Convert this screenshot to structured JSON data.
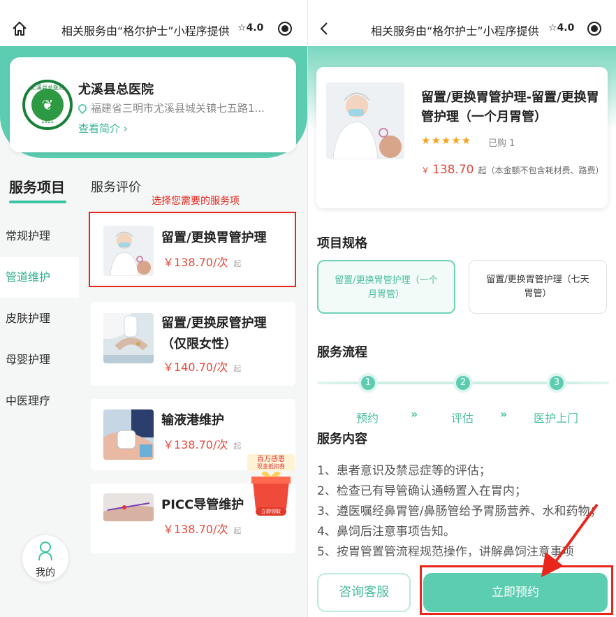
{
  "left": {
    "topbar": {
      "title": "相关服务由“格尔护士”小程序提供",
      "rating": "4.0"
    },
    "hospital": {
      "name": "尤溪县总医院",
      "address": "福建省三明市尤溪县城关镇七五路1...",
      "intro_link": "查看简介",
      "logo_text": "尤溪县总医院",
      "logo_year": "1921"
    },
    "tabs": {
      "active": "服务项目",
      "inactive": "服务评价"
    },
    "categories": [
      "常规护理",
      "管道维护",
      "皮肤护理",
      "母婴护理",
      "中医理疗"
    ],
    "active_category": "管道维护",
    "annotation": "选择您需要的服务项",
    "services": [
      {
        "name": "留置/更换胃管护理",
        "price": "￥138.70/次",
        "suffix": "起"
      },
      {
        "name": "留置/更换尿管护理（仅限女性）",
        "price": "￥140.70/次",
        "suffix": "起"
      },
      {
        "name": "输液港维护",
        "price": "￥138.70/次",
        "suffix": "起"
      },
      {
        "name": "PICC导管维护",
        "price": "￥138.70/次",
        "suffix": "起"
      }
    ],
    "promo": {
      "line1": "百万感恩",
      "line2": "现金抵扣券",
      "button": "立即领取"
    },
    "me_label": "我的"
  },
  "right": {
    "topbar": {
      "title": "相关服务由“格尔护士”小程序提供",
      "rating": "4.0"
    },
    "product": {
      "title": "留置/更换胃管护理-留置/更换胃管护理（一个月胃管）",
      "stars": "★★★★★",
      "sold": "已购 1",
      "currency": "￥",
      "price": "138.70",
      "price_suffix": "起",
      "price_note": "（本金额不包含耗材费、路费）"
    },
    "spec_title": "项目规格",
    "specs": [
      {
        "label": "留置/更换胃管护理（一个月胃管）",
        "selected": true
      },
      {
        "label": "留置/更换胃管护理（七天胃管）",
        "selected": false
      }
    ],
    "flow_title": "服务流程",
    "flow_steps": [
      {
        "num": "1",
        "label": "预约"
      },
      {
        "num": "2",
        "label": "评估"
      },
      {
        "num": "3",
        "label": "医护上门"
      }
    ],
    "chevron": "»",
    "content_title": "服务内容",
    "content_lines": [
      "1、患者意识及禁忌症等的评估；",
      "2、检查已有导管确认通畅置入在胃内；",
      "3、遵医嘱经鼻胃管/鼻肠管给予胃肠营养、水和药物；",
      "4、鼻饲后注意事项告知。",
      "5、按胃管置管流程规范操作，讲解鼻饲注意事项"
    ],
    "buttons": {
      "consult": "咨询客服",
      "book": "立即预约"
    }
  },
  "colors": {
    "brand": "#5ccdb1",
    "accent_text": "#2cae8e",
    "price": "#e24a3b",
    "annotation": "#e8261c"
  }
}
